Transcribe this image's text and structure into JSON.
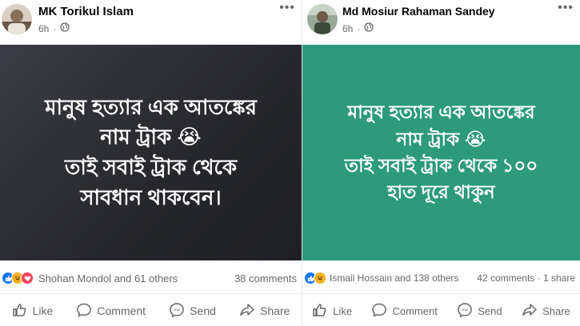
{
  "posts": [
    {
      "author": "MK Torikul Islam",
      "time": "6h",
      "media_lines": [
        "মানুষ হত্যার এক আতঙ্কের",
        "নাম ট্রাক 😭",
        "তাই সবাই ট্রাক থেকে",
        "সাবধান থাকবেন।"
      ],
      "reactions_text": "Shohan Mondol and 61 others",
      "comments_text": "38 comments",
      "actions": {
        "like": "Like",
        "comment": "Comment",
        "send": "Send",
        "share": "Share"
      }
    },
    {
      "author": "Md Mosiur Rahaman Sandey",
      "time": "6h",
      "media_lines": [
        "মানুষ হত্যার এক আতঙ্কের",
        "নাম ট্রাক 😭",
        "তাই সবাই ট্রাক থেকে ১০০",
        "হাত দূরে থাকুন"
      ],
      "reactions_text": "Ismail Hossain and 138 others",
      "comments_text": "42 comments · 1 share",
      "actions": {
        "like": "Like",
        "comment": "Comment",
        "send": "Send",
        "share": "Share"
      }
    }
  ],
  "icons": [
    "globe-icon",
    "more-icon",
    "like-reaction-icon",
    "haha-reaction-icon",
    "love-reaction-icon",
    "thumbs-up-icon",
    "comment-icon",
    "messenger-icon",
    "share-icon"
  ],
  "colors": {
    "left_background": "#2b2c32",
    "right_background": "#2c9a7b",
    "like_blue": "#1877f2",
    "secondary_text": "#65676b"
  }
}
